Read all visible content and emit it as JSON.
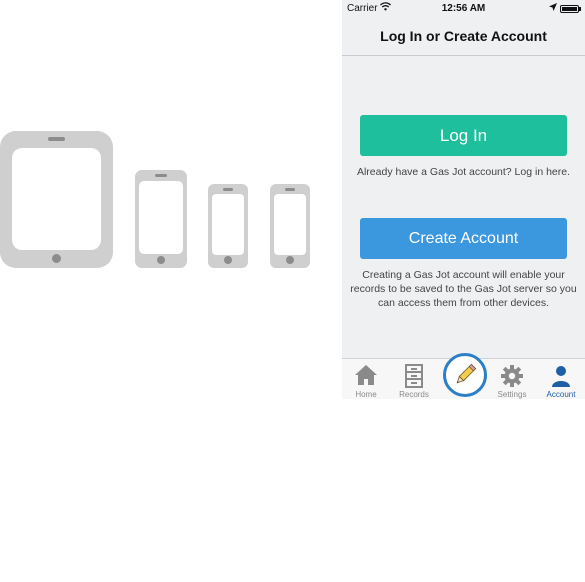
{
  "status_bar": {
    "carrier": "Carrier",
    "time": "12:56 AM",
    "location_icon": "location-arrow-icon",
    "wifi_icon": "wifi-icon",
    "battery_icon": "battery-icon"
  },
  "nav": {
    "title": "Log In or Create Account"
  },
  "login": {
    "button_label": "Log In",
    "hint": "Already have a Gas Jot account?  Log in here."
  },
  "create": {
    "button_label": "Create Account",
    "description": "Creating a Gas Jot account will enable your records to be saved to the Gas Jot server so you can access them from other devices."
  },
  "tabs": [
    {
      "label": "Home",
      "icon": "home-icon"
    },
    {
      "label": "Records",
      "icon": "file-cabinet-icon"
    },
    {
      "label": "",
      "icon": "pencil-icon"
    },
    {
      "label": "Settings",
      "icon": "gear-icon"
    },
    {
      "label": "Account",
      "icon": "user-icon"
    }
  ],
  "colors": {
    "login_button": "#1dbf9c",
    "create_button": "#3b97de",
    "active_tab": "#1f5fa6",
    "device_gray": "#cfcfcf"
  },
  "device_icons": [
    "tablet-icon",
    "phone-large-icon",
    "phone-medium-icon",
    "phone-small-icon"
  ]
}
